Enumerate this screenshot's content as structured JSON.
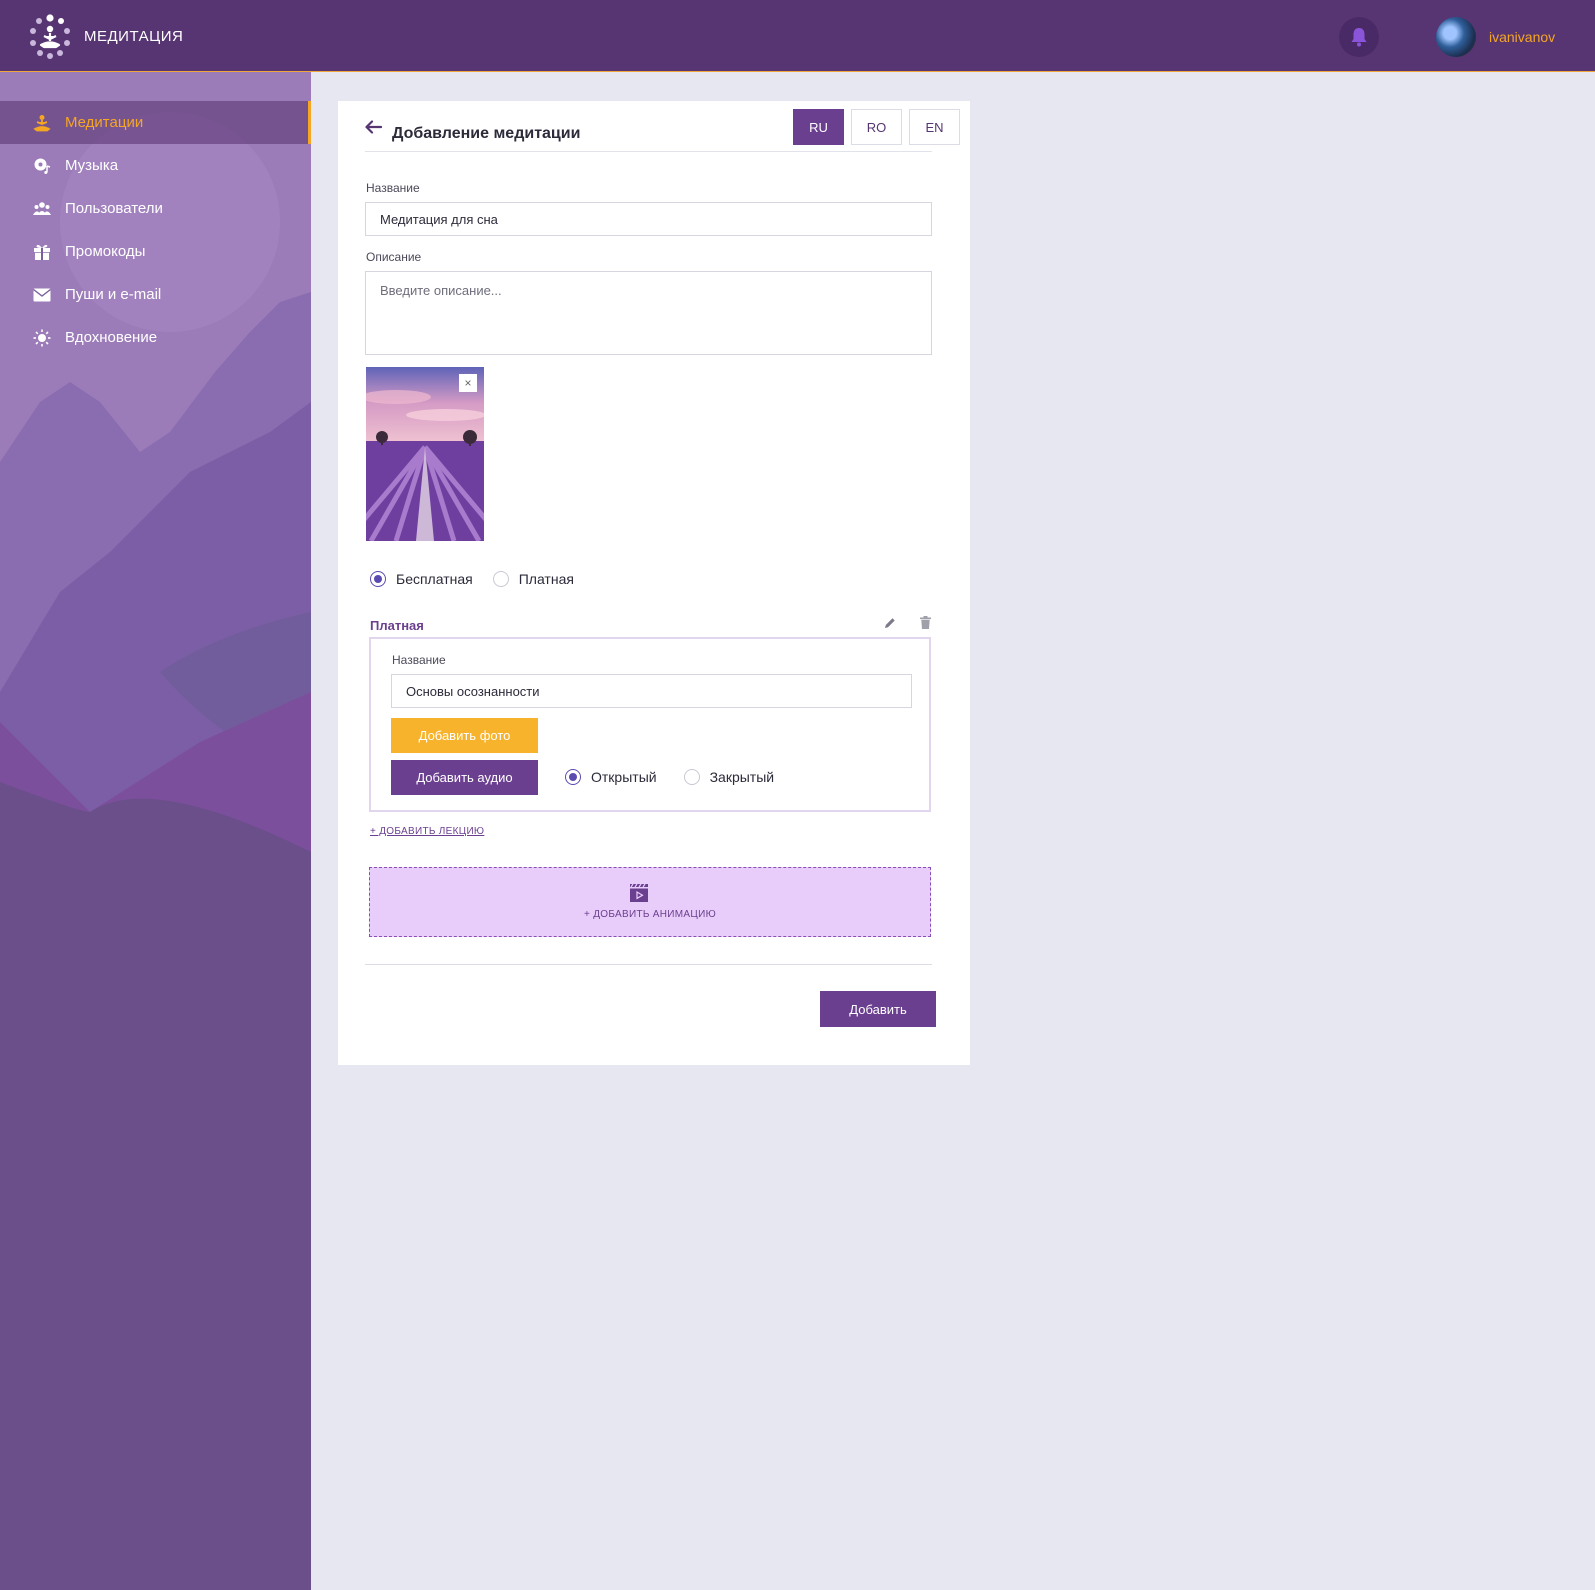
{
  "header": {
    "app_title": "МЕДИТАЦИЯ",
    "username": "ivanivanov",
    "icons": [
      "logo-icon",
      "bell-icon",
      "avatar"
    ]
  },
  "sidebar": {
    "items": [
      {
        "label": "Медитации",
        "icon": "meditation-icon",
        "active": true
      },
      {
        "label": "Музыка",
        "icon": "music-icon",
        "active": false
      },
      {
        "label": "Пользователи",
        "icon": "users-icon",
        "active": false
      },
      {
        "label": "Промокоды",
        "icon": "gift-icon",
        "active": false
      },
      {
        "label": "Пуши и e-mail",
        "icon": "mail-icon",
        "active": false
      },
      {
        "label": "Вдохновение",
        "icon": "sun-icon",
        "active": false
      }
    ]
  },
  "form": {
    "title": "Добавление медитации",
    "languages": [
      {
        "label": "RU",
        "active": true
      },
      {
        "label": "RO",
        "active": false
      },
      {
        "label": "EN",
        "active": false
      }
    ],
    "name_label": "Название",
    "name_value": "Медитация для сна",
    "description_label": "Описание",
    "description_placeholder": "Введите описание...",
    "image_close": "×",
    "pricing": [
      {
        "label": "Бесплатная",
        "checked": true
      },
      {
        "label": "Платная",
        "checked": false
      }
    ],
    "lecture": {
      "section_title": "Платная",
      "name_label": "Название",
      "name_value": "Основы осознанности",
      "add_photo": "Добавить фото",
      "add_audio": "Добавить аудио",
      "access": [
        {
          "label": "Открытый",
          "checked": true
        },
        {
          "label": "Закрытый",
          "checked": false
        }
      ]
    },
    "add_lecture": "+ ДОБАВИТЬ ЛЕКЦИЮ",
    "add_animation": "+ ДОБАВИТЬ АНИМАЦИЮ",
    "submit": "Добавить"
  },
  "colors": {
    "primary": "#573572",
    "accent": "#f5a623",
    "button_purple": "#6b3f8f",
    "dropzone": "#e8cdfa",
    "background": "#e7e7f2"
  }
}
